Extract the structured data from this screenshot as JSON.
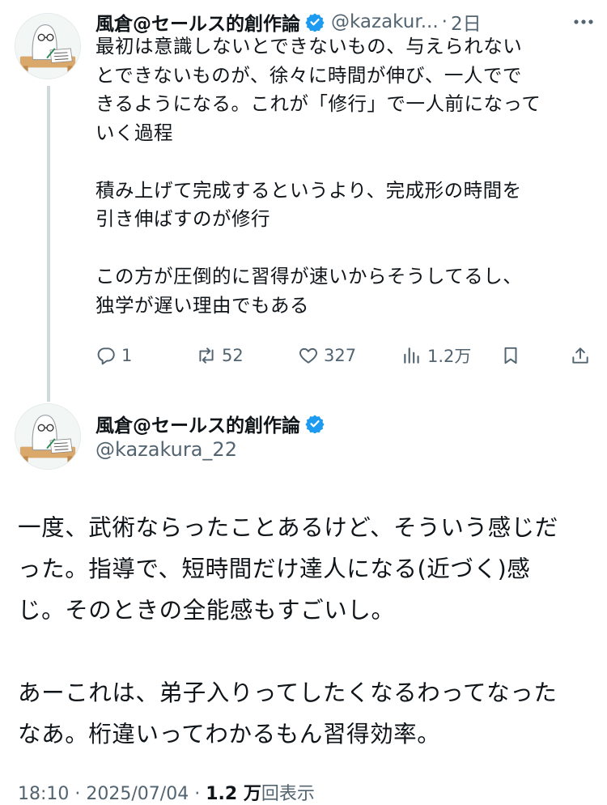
{
  "reply": {
    "author_name": "風倉@セールス的創作論",
    "handle": "@kazakur...",
    "separator": "·",
    "time": "2日",
    "paragraphs": [
      [
        "最初は意識しないとできないもの、与えられない",
        "とできないものが、徐々に時間が伸び、一人でで",
        "きるようになる。これが「修行」で一人前になって",
        "いく過程"
      ],
      [
        "積み上げて完成するというより、完成形の時間を",
        "引き伸ばすのが修行"
      ],
      [
        "この方が圧倒的に習得が速いからそうしてるし、",
        "独学が遅い理由でもある"
      ]
    ],
    "actions": {
      "reply_count": "1",
      "retweet_count": "52",
      "like_count": "327",
      "view_count": "1.2万"
    }
  },
  "main_post": {
    "author_name": "風倉@セールス的創作論",
    "handle": "@kazakura_22",
    "paragraphs": [
      [
        "一度、武術ならったことあるけど、そういう感じだ",
        "った。指導で、短時間だけ達人になる(近づく)感",
        "じ。そのときの全能感もすごいし。"
      ],
      [
        "あーこれは、弟子入りってしたくなるわってなった",
        "なあ。桁違いってわかるもん習得効率。"
      ]
    ],
    "meta": {
      "time": "18:10",
      "sep1": " · ",
      "date": "2025/07/04",
      "sep2": " · ",
      "views": "1.2 万",
      "views_label": "回表示"
    }
  },
  "icons": {
    "verified": "verified-badge-icon",
    "more": "more-icon",
    "reply": "reply-icon",
    "retweet": "retweet-icon",
    "like": "heart-icon",
    "views": "views-icon",
    "bookmark": "bookmark-icon",
    "share": "share-icon"
  },
  "colors": {
    "verified": "#1d9bf0",
    "text": "#0f1419",
    "secondary": "#536471",
    "thread_line": "#cfd9de"
  }
}
